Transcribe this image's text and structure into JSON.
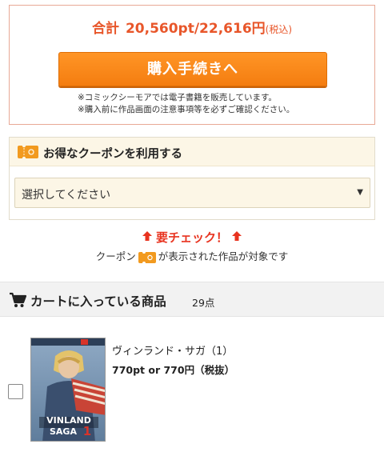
{
  "summary": {
    "total_label": "合計",
    "total_value": "20,560pt/22,616円",
    "total_tax": "(税込)",
    "checkout_label": "購入手続きへ",
    "notes": [
      "※コミックシーモアでは電子書籍を販売しています。",
      "※購入前に作品画面の注意事項等を必ずご確認ください。"
    ]
  },
  "coupon": {
    "title": "お得なクーポンを利用する",
    "select_value": "選択してください",
    "check_text": "要チェック！",
    "note_before": "クーポン",
    "note_after": "が表示された作品が対象です"
  },
  "cart": {
    "title": "カートに入っている商品",
    "count": "29点",
    "items": [
      {
        "title": "ヴィンランド・サガ（1）",
        "price": "770pt or 770円（税抜）",
        "cover_text": "VINLAND SAGA 1"
      }
    ]
  },
  "colors": {
    "accent": "#e8562a",
    "button": "#f47d10",
    "alert": "#e8331f",
    "coupon_bg": "#fcf6e6"
  }
}
